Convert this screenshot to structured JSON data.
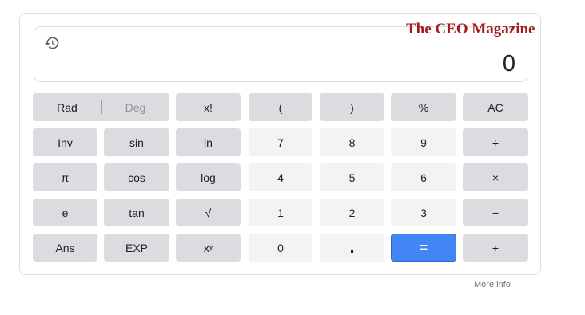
{
  "watermark": "The CEO Magazine",
  "display": {
    "value": "0"
  },
  "angle_toggle": {
    "rad_label": "Rad",
    "deg_label": "Deg"
  },
  "keys": {
    "factorial": "x!",
    "open_paren": "(",
    "close_paren": ")",
    "percent": "%",
    "all_clear": "AC",
    "inv": "Inv",
    "sin": "sin",
    "ln": "ln",
    "seven": "7",
    "eight": "8",
    "nine": "9",
    "divide": "÷",
    "pi": "π",
    "cos": "cos",
    "log": "log",
    "four": "4",
    "five": "5",
    "six": "6",
    "multiply": "×",
    "e": "e",
    "tan": "tan",
    "sqrt": "√",
    "one": "1",
    "two": "2",
    "three": "3",
    "minus": "−",
    "ans": "Ans",
    "exp": "EXP",
    "power": "xʸ",
    "zero": "0",
    "dot": ".",
    "equals": "=",
    "plus": "+"
  },
  "footer": {
    "more_info": "More info"
  },
  "colors": {
    "function_key": "#dadce0",
    "number_key": "#f1f3f4",
    "equals_key": "#4285f4",
    "watermark": "#a31a1d"
  }
}
